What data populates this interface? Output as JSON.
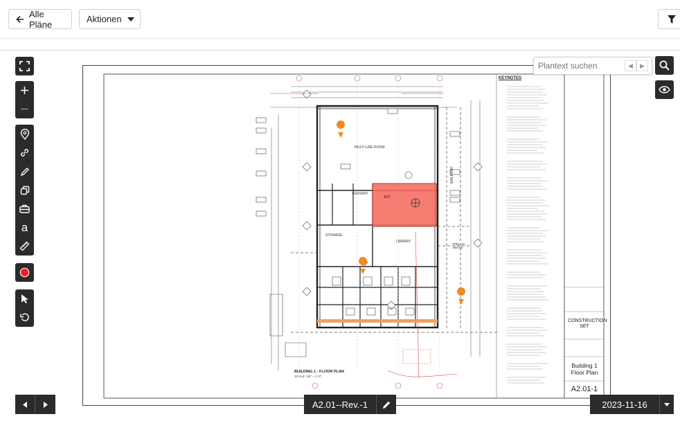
{
  "toolbar": {
    "back_label": "Alle Pläne",
    "actions_label": "Aktionen"
  },
  "search": {
    "placeholder": "Plantext suchen"
  },
  "sheet": {
    "keynotes_title": "KEYNOTES",
    "room_labels": [
      "MULTI-USE ROOM",
      "SERVERY",
      "STORAGE",
      "LIBRARY",
      "ART"
    ],
    "plan_title": "BUILDING 1 - FLOOR PLAN",
    "scale": "SCALE: 1/8\" = 1'-0\"",
    "stamp_title": "CONSTRUCTION SET",
    "drawing_title_line1": "Building 1",
    "drawing_title_line2": "Floor Plan",
    "sheet_number": "A2.01-1",
    "walkway_label": "WALKWAY",
    "trellis_label": "TRELLIS ABOVE"
  },
  "footer": {
    "revision_label": "A2.01--Rev.-1",
    "date_label": "2023-11-16"
  },
  "colors": {
    "toolbar_dark": "#2b2b2b",
    "pin_orange": "#f08a24",
    "highlight_red": "#f56b5f",
    "highlight_orange": "#f0a060",
    "record_red": "#ff1a1a"
  },
  "icons": [
    "arrow-left-icon",
    "caret-down-icon",
    "filter-icon",
    "fullscreen-icon",
    "zoom-in-icon",
    "zoom-out-icon",
    "location-pin-icon",
    "link-icon",
    "pen-icon",
    "copy-icon",
    "briefcase-icon",
    "text-icon",
    "ruler-icon",
    "record-icon",
    "cursor-icon",
    "undo-icon",
    "search-icon",
    "eye-icon",
    "chevron-left-icon",
    "chevron-right-icon",
    "pencil-icon"
  ]
}
